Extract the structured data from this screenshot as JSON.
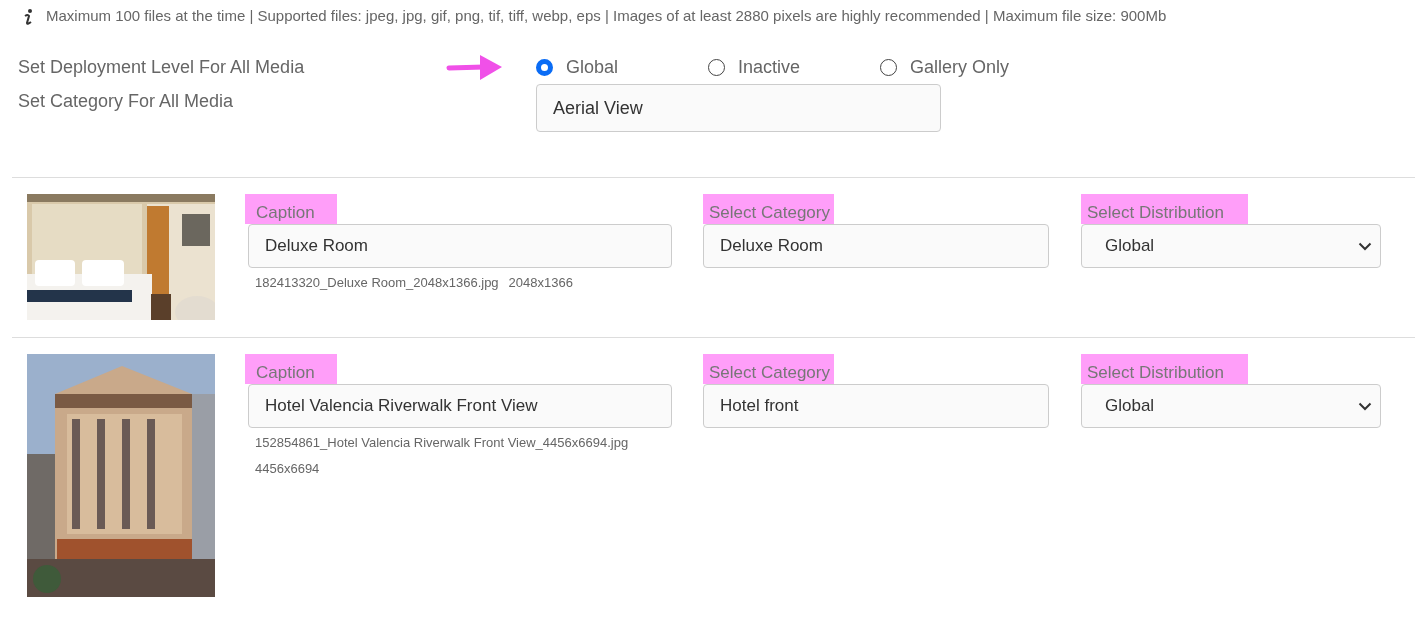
{
  "info": "Maximum 100 files at the time | Supported files: jpeg, jpg, gif, png, tif, tiff, webp, eps | Images of at least 2880 pixels are highly recommended | Maximum file size: 900Mb",
  "deployment": {
    "label": "Set Deployment Level For All Media",
    "options": [
      {
        "label": "Global",
        "selected": true
      },
      {
        "label": "Inactive",
        "selected": false
      },
      {
        "label": "Gallery Only",
        "selected": false
      }
    ]
  },
  "category": {
    "label": "Set Category For All Media",
    "value": "Aerial View"
  },
  "media": [
    {
      "caption_label": "Caption",
      "caption": "Deluxe Room",
      "file_name": "182413320_Deluxe Room_2048x1366.jpg",
      "dimensions": "2048x1366",
      "category_label": "Select Category",
      "category": "Deluxe Room",
      "distribution_label": "Select Distribution",
      "distribution": "Global"
    },
    {
      "caption_label": "Caption",
      "caption": "Hotel Valencia Riverwalk Front View",
      "file_name": "152854861_Hotel Valencia Riverwalk Front View_4456x6694.jpg",
      "dimensions": "4456x6694",
      "category_label": "Select Category",
      "category": "Hotel front",
      "distribution_label": "Select Distribution",
      "distribution": "Global"
    }
  ]
}
